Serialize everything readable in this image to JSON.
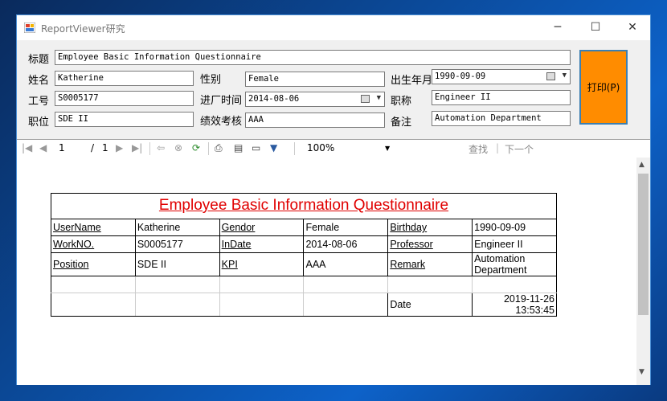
{
  "window": {
    "title": "ReportViewer研究",
    "minimize": "─",
    "maximize": "☐",
    "close": "✕"
  },
  "form": {
    "title_label": "标题",
    "title_value": "Employee Basic Information Questionnaire",
    "name_label": "姓名",
    "name_value": "Katherine",
    "gender_label": "性别",
    "gender_value": "Female",
    "birth_label": "出生年月",
    "birth_value": "1990-09-09",
    "id_label": "工号",
    "id_value": "S0005177",
    "indate_label": "进厂时间",
    "indate_value": "2014-08-06",
    "prof_label": "职称",
    "prof_value": "Engineer II",
    "pos_label": "职位",
    "pos_value": "SDE II",
    "kpi_label": "绩效考核",
    "kpi_value": "AAA",
    "remark_label": "备注",
    "remark_value": "Automation Department",
    "print_button": "打印(P)"
  },
  "toolbar": {
    "page_current": "1",
    "page_sep": "/",
    "page_total": "1",
    "zoom": "100%",
    "find": "查找",
    "find_sep": "|",
    "next": "下一个"
  },
  "report": {
    "caption": "Employee Basic Information Questionnaire",
    "rows": [
      [
        "UserName",
        "Katherine",
        "Gendor",
        "Female",
        "Birthday",
        "1990-09-09"
      ],
      [
        "WorkNO.",
        "S0005177",
        "InDate",
        "2014-08-06",
        "Professor",
        "Engineer II"
      ],
      [
        "Position",
        "SDE II",
        "KPI",
        "AAA",
        "Remark",
        "Automation Department"
      ]
    ],
    "date_label": "Date",
    "date_value": "2019-11-26 13:53:45"
  },
  "colors": {
    "print_button": "#ff8c00",
    "caption": "#e00000",
    "window_border": "#4a8fd6"
  }
}
